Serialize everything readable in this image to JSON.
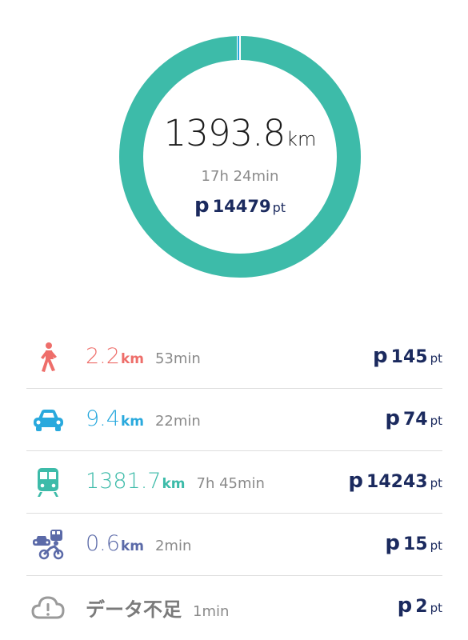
{
  "summary": {
    "distance_value": "1393.8",
    "distance_unit": "km",
    "duration": "17h 24min",
    "points_symbol": "p",
    "points_value": "14479",
    "points_unit": "pt"
  },
  "ring": {
    "main_color": "#3dbba9",
    "accent_color": "#29a9dd",
    "track_color": "#e6e6e6"
  },
  "activities": [
    {
      "icon": "walking-person-icon",
      "color": "#ee6e6a",
      "distance": "2.2",
      "unit": "km",
      "duration": "53min",
      "points_symbol": "p",
      "points": "145",
      "points_unit": "pt"
    },
    {
      "icon": "car-icon",
      "color": "#29a9dd",
      "distance": "9.4",
      "unit": "km",
      "duration": "22min",
      "points_symbol": "p",
      "points": "74",
      "points_unit": "pt"
    },
    {
      "icon": "train-icon",
      "color": "#3dbba9",
      "distance": "1381.7",
      "unit": "km",
      "duration": "7h 45min",
      "points_symbol": "p",
      "points": "14243",
      "points_unit": "pt"
    },
    {
      "icon": "mixed-transport-icon",
      "color": "#5b6aa8",
      "distance": "0.6",
      "unit": "km",
      "duration": "2min",
      "points_symbol": "p",
      "points": "15",
      "points_unit": "pt"
    },
    {
      "icon": "cloud-alert-icon",
      "color": "#9a9a9a",
      "label": "データ不足",
      "duration": "1min",
      "points_symbol": "p",
      "points": "2",
      "points_unit": "pt"
    }
  ]
}
